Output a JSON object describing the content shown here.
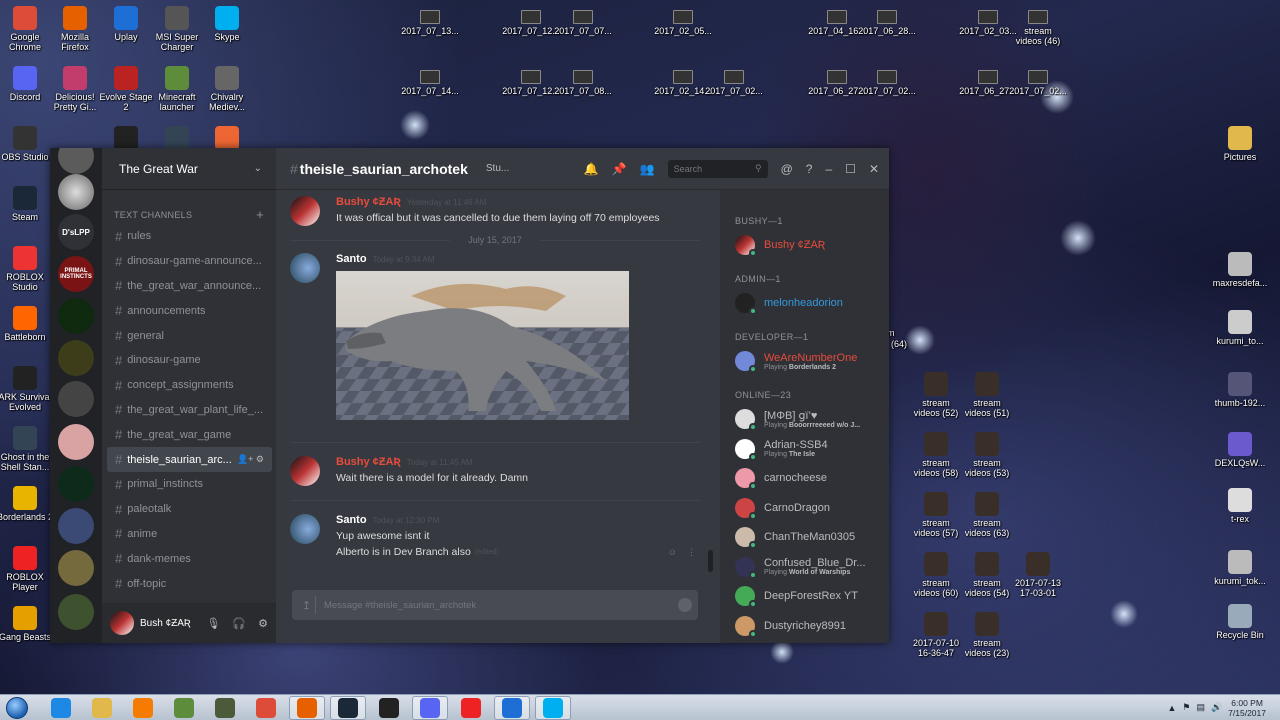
{
  "desktop": {
    "icons_left": [
      {
        "label": "Google\nChrome",
        "icon": "chrome-icon",
        "color": "#dd4b39"
      },
      {
        "label": "Mozilla\nFirefox",
        "icon": "firefox-icon",
        "color": "#e66000"
      },
      {
        "label": "Uplay",
        "icon": "uplay-icon",
        "color": "#1d6fd6"
      },
      {
        "label": "MSI Super\nCharger",
        "icon": "msi-icon",
        "color": "#555"
      },
      {
        "label": "Skype",
        "icon": "skype-icon",
        "color": "#00aff0"
      },
      {
        "label": "Discord",
        "icon": "discord-icon",
        "color": "#5865f2"
      },
      {
        "label": "Delicious!\nPretty Gi...",
        "icon": "game-icon",
        "color": "#c23d6b"
      },
      {
        "label": "Evolve Stage\n2",
        "icon": "evolve-icon",
        "color": "#b22"
      },
      {
        "label": "Minecraft\nlauncher",
        "icon": "minecraft-icon",
        "color": "#5d8c3b"
      },
      {
        "label": "Chivalry\nMediev...",
        "icon": "chivalry-icon",
        "color": "#666"
      },
      {
        "label": "OBS Studio",
        "icon": "obs-icon",
        "color": "#333"
      },
      {
        "label": "Steam",
        "icon": "steam-icon",
        "color": "#1b2838"
      },
      {
        "label": "ROBLOX\nStudio",
        "icon": "roblox-studio-icon",
        "color": "#e33"
      },
      {
        "label": "Battleborn",
        "icon": "battleborn-icon",
        "color": "#f60"
      },
      {
        "label": "ARK Survival\nEvolved",
        "icon": "ark-icon",
        "color": "#222"
      },
      {
        "label": "Ghost in the\nShell Stan...",
        "icon": "ghost-icon",
        "color": "#345"
      },
      {
        "label": "Borderlands 2",
        "icon": "borderlands-icon",
        "color": "#e8b400"
      },
      {
        "label": "ROBLOX\nPlayer",
        "icon": "roblox-icon",
        "color": "#e22"
      },
      {
        "label": "Gang Beasts",
        "icon": "gangbeasts-icon",
        "color": "#e5a000"
      }
    ],
    "thumb_row1": [
      "2017_07_13...",
      "2017_07_12...",
      "2017_07_07...",
      "2017_02_05...",
      "2017_04_16...",
      "2017_06_28...",
      "2017_02_03...",
      "stream\nvideos (46)"
    ],
    "thumb_row2": [
      "2017_07_14...",
      "2017_07_12...",
      "2017_07_08...",
      "2017_02_14...",
      "2017_07_02...",
      "2017_06_27...",
      "2017_07_02...",
      "2017_06_27...",
      "2017_07_02..."
    ],
    "right_icons": [
      {
        "label": "Pictures",
        "icon": "folder-icon"
      },
      {
        "label": "maxresdefa...",
        "icon": "image-icon"
      },
      {
        "label": "kurumi_to...",
        "icon": "image-icon"
      },
      {
        "label": "thumb-192...",
        "icon": "image-icon"
      },
      {
        "label": "DEXLQsW...",
        "icon": "image-icon"
      },
      {
        "label": "t-rex",
        "icon": "image-icon"
      },
      {
        "label": "kurumi_tok...",
        "icon": "image-icon"
      },
      {
        "label": "Recycle Bin",
        "icon": "recycle-bin-icon"
      }
    ],
    "stream_icons": [
      "stream\nvideos (52)",
      "stream\nvideos (51)",
      "stream\nvideos (58)",
      "stream\nvideos (53)",
      "stream\nvideos (57)",
      "stream\nvideos (63)",
      "stream\nvideos (60)",
      "stream\nvideos (54)",
      "2017-07-13\n17-03-01",
      "2017-07-10\n16-36-47",
      "stream\nvideos (23)"
    ],
    "partial_labels": {
      "im": "im",
      "n64": "(64)"
    }
  },
  "discord": {
    "server_name": "The Great War",
    "guild_labels": {
      "dlpp": "D'sLPP",
      "primal": "PRIMAL\nINSTINCTS"
    },
    "category": "TEXT CHANNELS",
    "channels": [
      "rules",
      "dinosaur-game-announce...",
      "the_great_war_announce...",
      "announcements",
      "general",
      "dinosaur-game",
      "concept_assignments",
      "the_great_war_plant_life_...",
      "the_great_war_game",
      "theisle_saurian_arc...",
      "primal_instincts",
      "paleotalk",
      "anime",
      "dank-memes",
      "off-topic"
    ],
    "active_channel_index": 9,
    "user": {
      "name": "Bush ¢ƵΑƦ"
    },
    "channel_title": "theisle_saurian_archotek",
    "topic": "Stu...",
    "search_placeholder": "Search",
    "messages": [
      {
        "author": "Bushy ¢ƵΑƦ",
        "time": "Yesterday at 11:46 AM",
        "text": "It was offical but it was cancelled to due them laying off 70 employees",
        "color": "#e74c3c"
      },
      {
        "author": "Santo",
        "time": "Today at 9:34 AM",
        "text": "",
        "color": "#ffffff"
      },
      {
        "author": "Bushy ¢ƵΑƦ",
        "time": "Today at 11:45 AM",
        "text": "Wait there is a model for it already. Damn",
        "color": "#e74c3c"
      },
      {
        "author": "Santo",
        "time": "Today at 12:30 PM",
        "text": "Yup awesome isnt it",
        "text2": "Alberto is in Dev Branch also",
        "edited": "(edited)",
        "color": "#ffffff"
      }
    ],
    "date_divider": "July 15, 2017",
    "input_placeholder": "Message #theisle_saurian_archotek",
    "member_groups": [
      {
        "title": "BUSHY—1",
        "members": [
          {
            "name": "Bushy ¢ƵΑƦ",
            "color": "#e74c3c",
            "status": "",
            "game": ""
          }
        ]
      },
      {
        "title": "ADMIN—1",
        "members": [
          {
            "name": "melonheadorion",
            "color": "#3498db",
            "status": "",
            "game": ""
          }
        ]
      },
      {
        "title": "DEVELOPER—1",
        "members": [
          {
            "name": "WeAreNumberOne",
            "color": "#e74c3c",
            "status": "Playing ",
            "game": "Borderlands 2"
          }
        ]
      },
      {
        "title": "ONLINE—23",
        "members": [
          {
            "name": "[MΦB] ցї’♥",
            "color": "#b9bbbe",
            "status": "Playing ",
            "game": "Booorrreeeed w/o J..."
          },
          {
            "name": "Adrian-SSB4",
            "color": "#b9bbbe",
            "status": "Playing ",
            "game": "The Isle"
          },
          {
            "name": "carnocheese",
            "color": "#b9bbbe",
            "status": "",
            "game": ""
          },
          {
            "name": "CarnoDragon",
            "color": "#b9bbbe",
            "status": "",
            "game": ""
          },
          {
            "name": "ChanTheMan0305",
            "color": "#b9bbbe",
            "status": "",
            "game": ""
          },
          {
            "name": "Confused_Blue_Dr...",
            "color": "#b9bbbe",
            "status": "Playing ",
            "game": "World of Warships"
          },
          {
            "name": "DeepForestRex YT",
            "color": "#b9bbbe",
            "status": "",
            "game": ""
          },
          {
            "name": "Dustyrichey8991",
            "color": "#b9bbbe",
            "status": "",
            "game": ""
          }
        ]
      }
    ]
  },
  "taskbar": {
    "apps": [
      "ie-icon",
      "explorer-icon",
      "media-player-icon",
      "minecraft-icon",
      "cube-icon",
      "chrome-icon",
      "firefox-icon",
      "steam-icon",
      "obs-icon",
      "discord-icon",
      "roblox-icon",
      "uplay-icon",
      "skype-icon"
    ],
    "time": "6:00 PM",
    "date": "7/15/2017"
  }
}
